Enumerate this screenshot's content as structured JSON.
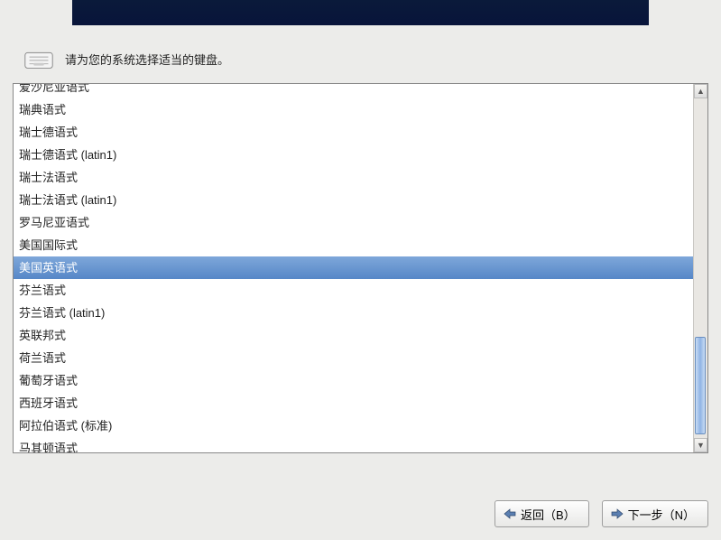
{
  "prompt": "请为您的系统选择适当的键盘。",
  "selected_index": 8,
  "keyboard_list": [
    "爱沙尼亚语式",
    "瑞典语式",
    "瑞士德语式",
    "瑞士德语式 (latin1)",
    "瑞士法语式",
    "瑞士法语式 (latin1)",
    "罗马尼亚语式",
    "美国国际式",
    "美国英语式",
    "芬兰语式",
    "芬兰语式 (latin1)",
    "英联邦式",
    "荷兰语式",
    "葡萄牙语式",
    "西班牙语式",
    "阿拉伯语式 (标准)",
    "马其顿语式"
  ],
  "buttons": {
    "back": "返回（B）",
    "next": "下一步（N）"
  }
}
